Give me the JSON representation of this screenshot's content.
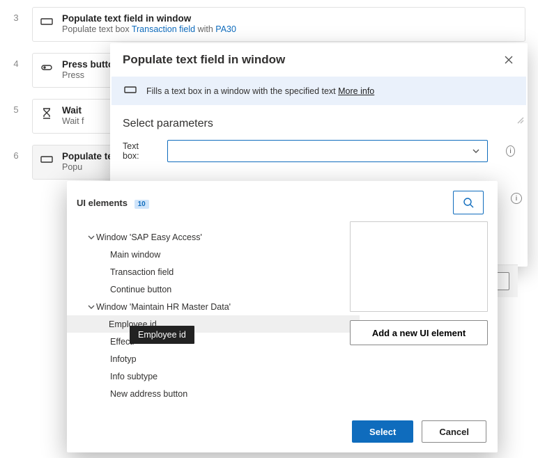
{
  "steps": [
    {
      "n": "3",
      "title": "Populate text field in window",
      "sub_pre": "Populate text box ",
      "link": "Transaction field",
      "sub_mid": " with ",
      "link2": "PA30"
    },
    {
      "n": "4",
      "title": "Press button in window",
      "sub_pre": "Press"
    },
    {
      "n": "5",
      "title": "Wait",
      "sub_pre": "Wait f"
    },
    {
      "n": "6",
      "title": "Populate text field in window",
      "sub_pre": "Popu"
    }
  ],
  "dlg": {
    "title": "Populate text field in window",
    "info": "Fills a text box in a window with the specified text ",
    "more": "More info",
    "section": "Select parameters",
    "param": "Text box:"
  },
  "picker": {
    "title": "UI elements",
    "badge": "10",
    "addBtn": "Add a new UI element",
    "select": "Select",
    "cancel": "Cancel",
    "tooltip": "Employee id",
    "tree": {
      "g1": "Window 'SAP Easy Access'",
      "g1a": "Main window",
      "g1b": "Transaction field",
      "g1c": "Continue button",
      "g2": "Window 'Maintain HR Master Data'",
      "g2a": "Employee id",
      "g2b": "Effecti",
      "g2c": "Infotyp",
      "g2d": "Info subtype",
      "g2e": "New address button"
    }
  }
}
